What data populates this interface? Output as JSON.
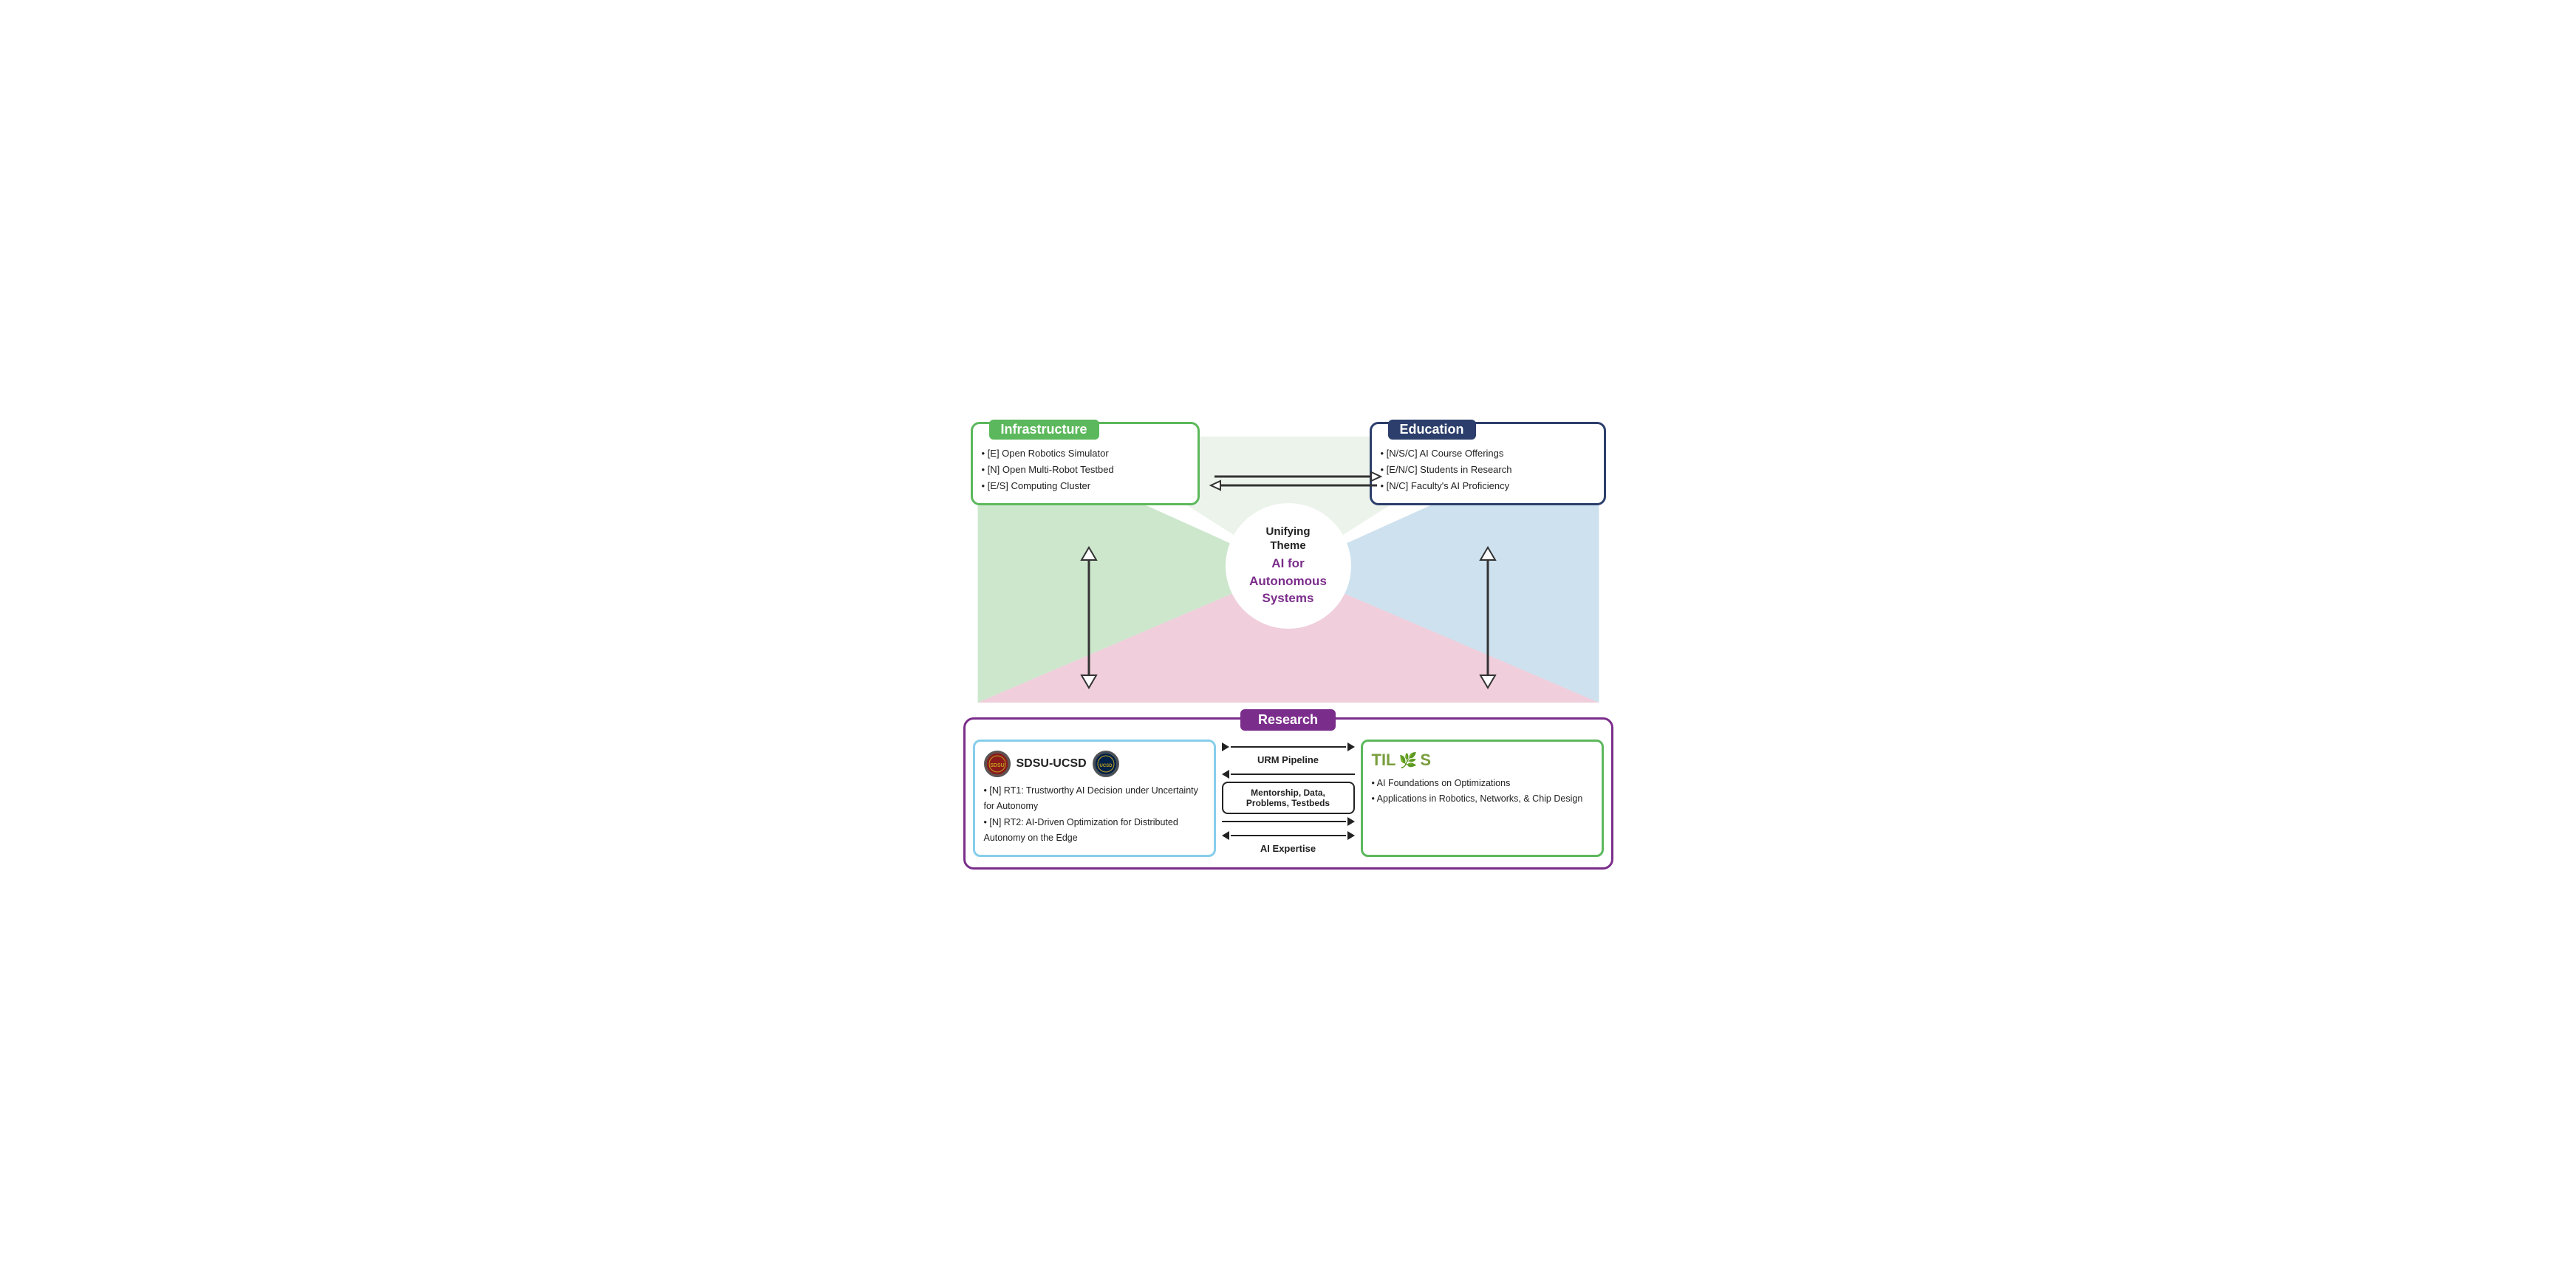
{
  "infrastructure": {
    "title": "Infrastructure",
    "items": [
      "[E] Open Robotics Simulator",
      "[N] Open Multi-Robot Testbed",
      "[E/S] Computing Cluster"
    ]
  },
  "education": {
    "title": "Education",
    "items": [
      "[N/S/C] AI Course Offerings",
      "[E/N/C] Students in Research",
      "[N/C] Faculty's AI Proficiency"
    ]
  },
  "center": {
    "unifying": "Unifying\nTheme",
    "ai": "AI for\nAutonomous\nSystems"
  },
  "research": {
    "title": "Research"
  },
  "sdsu": {
    "title": "SDSU-UCSD",
    "items": [
      "[N] RT1: Trustworthy AI Decision under Uncertainty for Autonomy",
      "[N] RT2: AI-Driven Optimization for Distributed Autonomy on the Edge"
    ]
  },
  "tilos": {
    "title": "TILOS",
    "items": [
      "AI Foundations on Optimizations",
      "Applications in Robotics, Networks, & Chip Design"
    ]
  },
  "pipeline": {
    "urm": "URM Pipeline",
    "mentorship": "Mentorship, Data,\nProblems, Testbeds",
    "expertise": "AI Expertise"
  }
}
